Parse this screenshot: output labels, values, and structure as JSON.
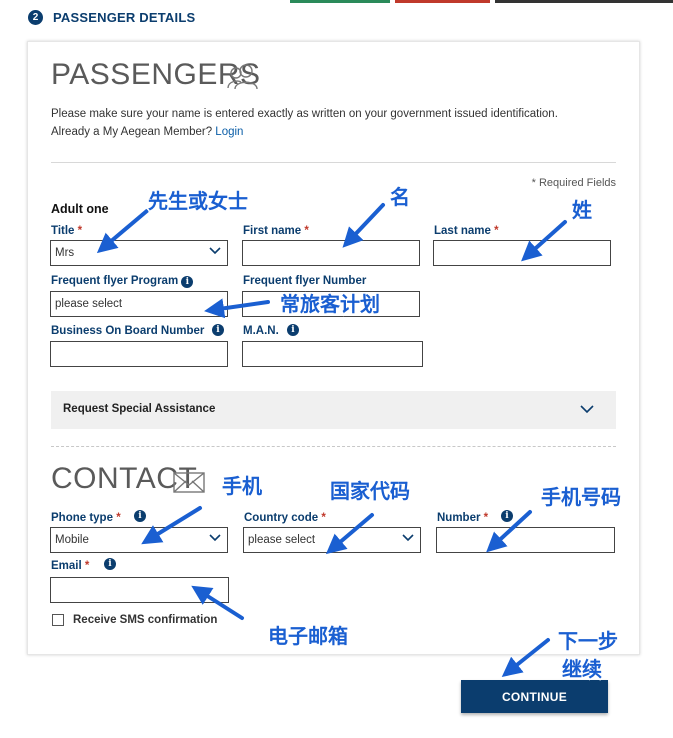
{
  "colors": {
    "accent": "#0b3d6e",
    "required": "#c0392b",
    "annotation": "#1a5fd1",
    "link": "#0b5ea8"
  },
  "header": {
    "step_number": "2",
    "step_title": "PASSENGER DETAILS"
  },
  "passengers": {
    "title": "PASSENGERS",
    "title_icon": "people-icon",
    "instruction": "Please make sure your name is entered exactly as written on your government issued identification.",
    "member_prompt": "Already a My Aegean Member?",
    "login_link": "Login",
    "required_note": "* Required Fields",
    "adult_label": "Adult one",
    "title_label": "Title",
    "title_value": "Mrs",
    "first_name_label": "First name",
    "last_name_label": "Last name",
    "ffp_label": "Frequent flyer Program",
    "ffp_placeholder": "please select",
    "ff_number_label": "Frequent flyer Number",
    "business_label": "Business On Board Number",
    "man_label": "M.A.N.",
    "assistance_label": "Request Special Assistance",
    "required_star": "*"
  },
  "contact": {
    "title": "CONTACT",
    "title_icon": "envelope-icon",
    "phone_type_label": "Phone type",
    "phone_type_value": "Mobile",
    "country_code_label": "Country code",
    "country_code_placeholder": "please select",
    "number_label": "Number",
    "email_label": "Email",
    "sms_label": "Receive SMS confirmation"
  },
  "actions": {
    "continue_label": "CONTINUE"
  },
  "annotations": {
    "title": "先生或女士",
    "first_name": "名",
    "last_name": "姓",
    "ffp": "常旅客计划",
    "phone_type": "手机",
    "country_code": "国家代码",
    "number": "手机号码",
    "email": "电子邮箱",
    "next_line1": "下一步",
    "next_line2": "继续"
  }
}
